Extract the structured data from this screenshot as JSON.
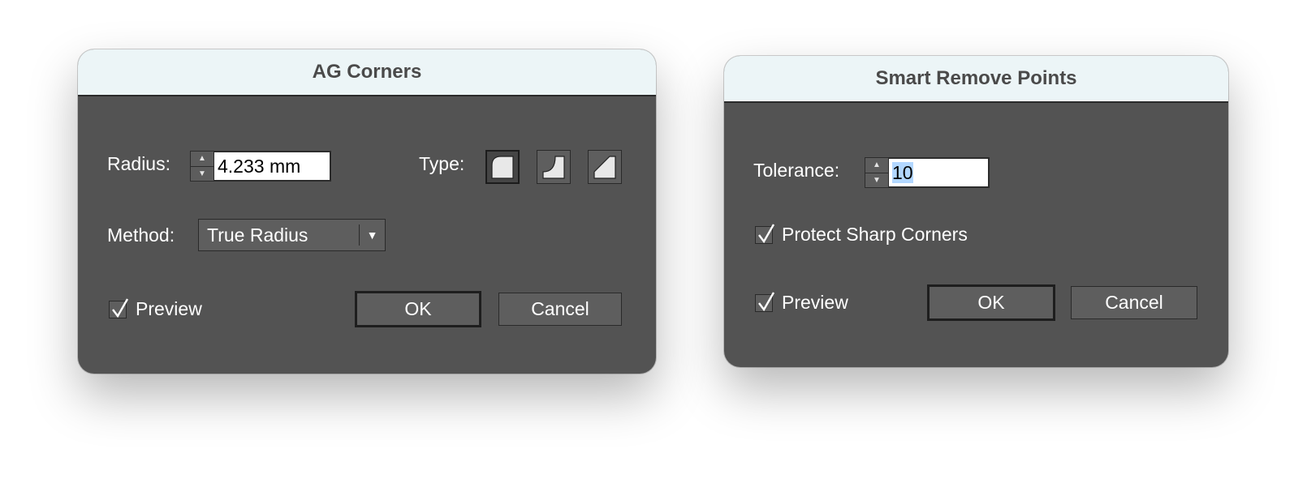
{
  "ag_corners": {
    "title": "AG Corners",
    "radius_label": "Radius:",
    "radius_value": "4.233 mm",
    "type_label": "Type:",
    "type_icons": [
      "round-corner-icon",
      "inverted-round-corner-icon",
      "chamfer-corner-icon"
    ],
    "method_label": "Method:",
    "method_value": "True Radius",
    "preview_label": "Preview",
    "preview_checked": true,
    "ok_label": "OK",
    "cancel_label": "Cancel"
  },
  "smart_remove": {
    "title": "Smart Remove Points",
    "tolerance_label": "Tolerance:",
    "tolerance_value": "10",
    "protect_label": "Protect Sharp Corners",
    "protect_checked": true,
    "preview_label": "Preview",
    "preview_checked": true,
    "ok_label": "OK",
    "cancel_label": "Cancel"
  },
  "colors": {
    "titlebar": "#ecf5f7",
    "panel": "#535353",
    "selection": "#b2d7ff"
  }
}
